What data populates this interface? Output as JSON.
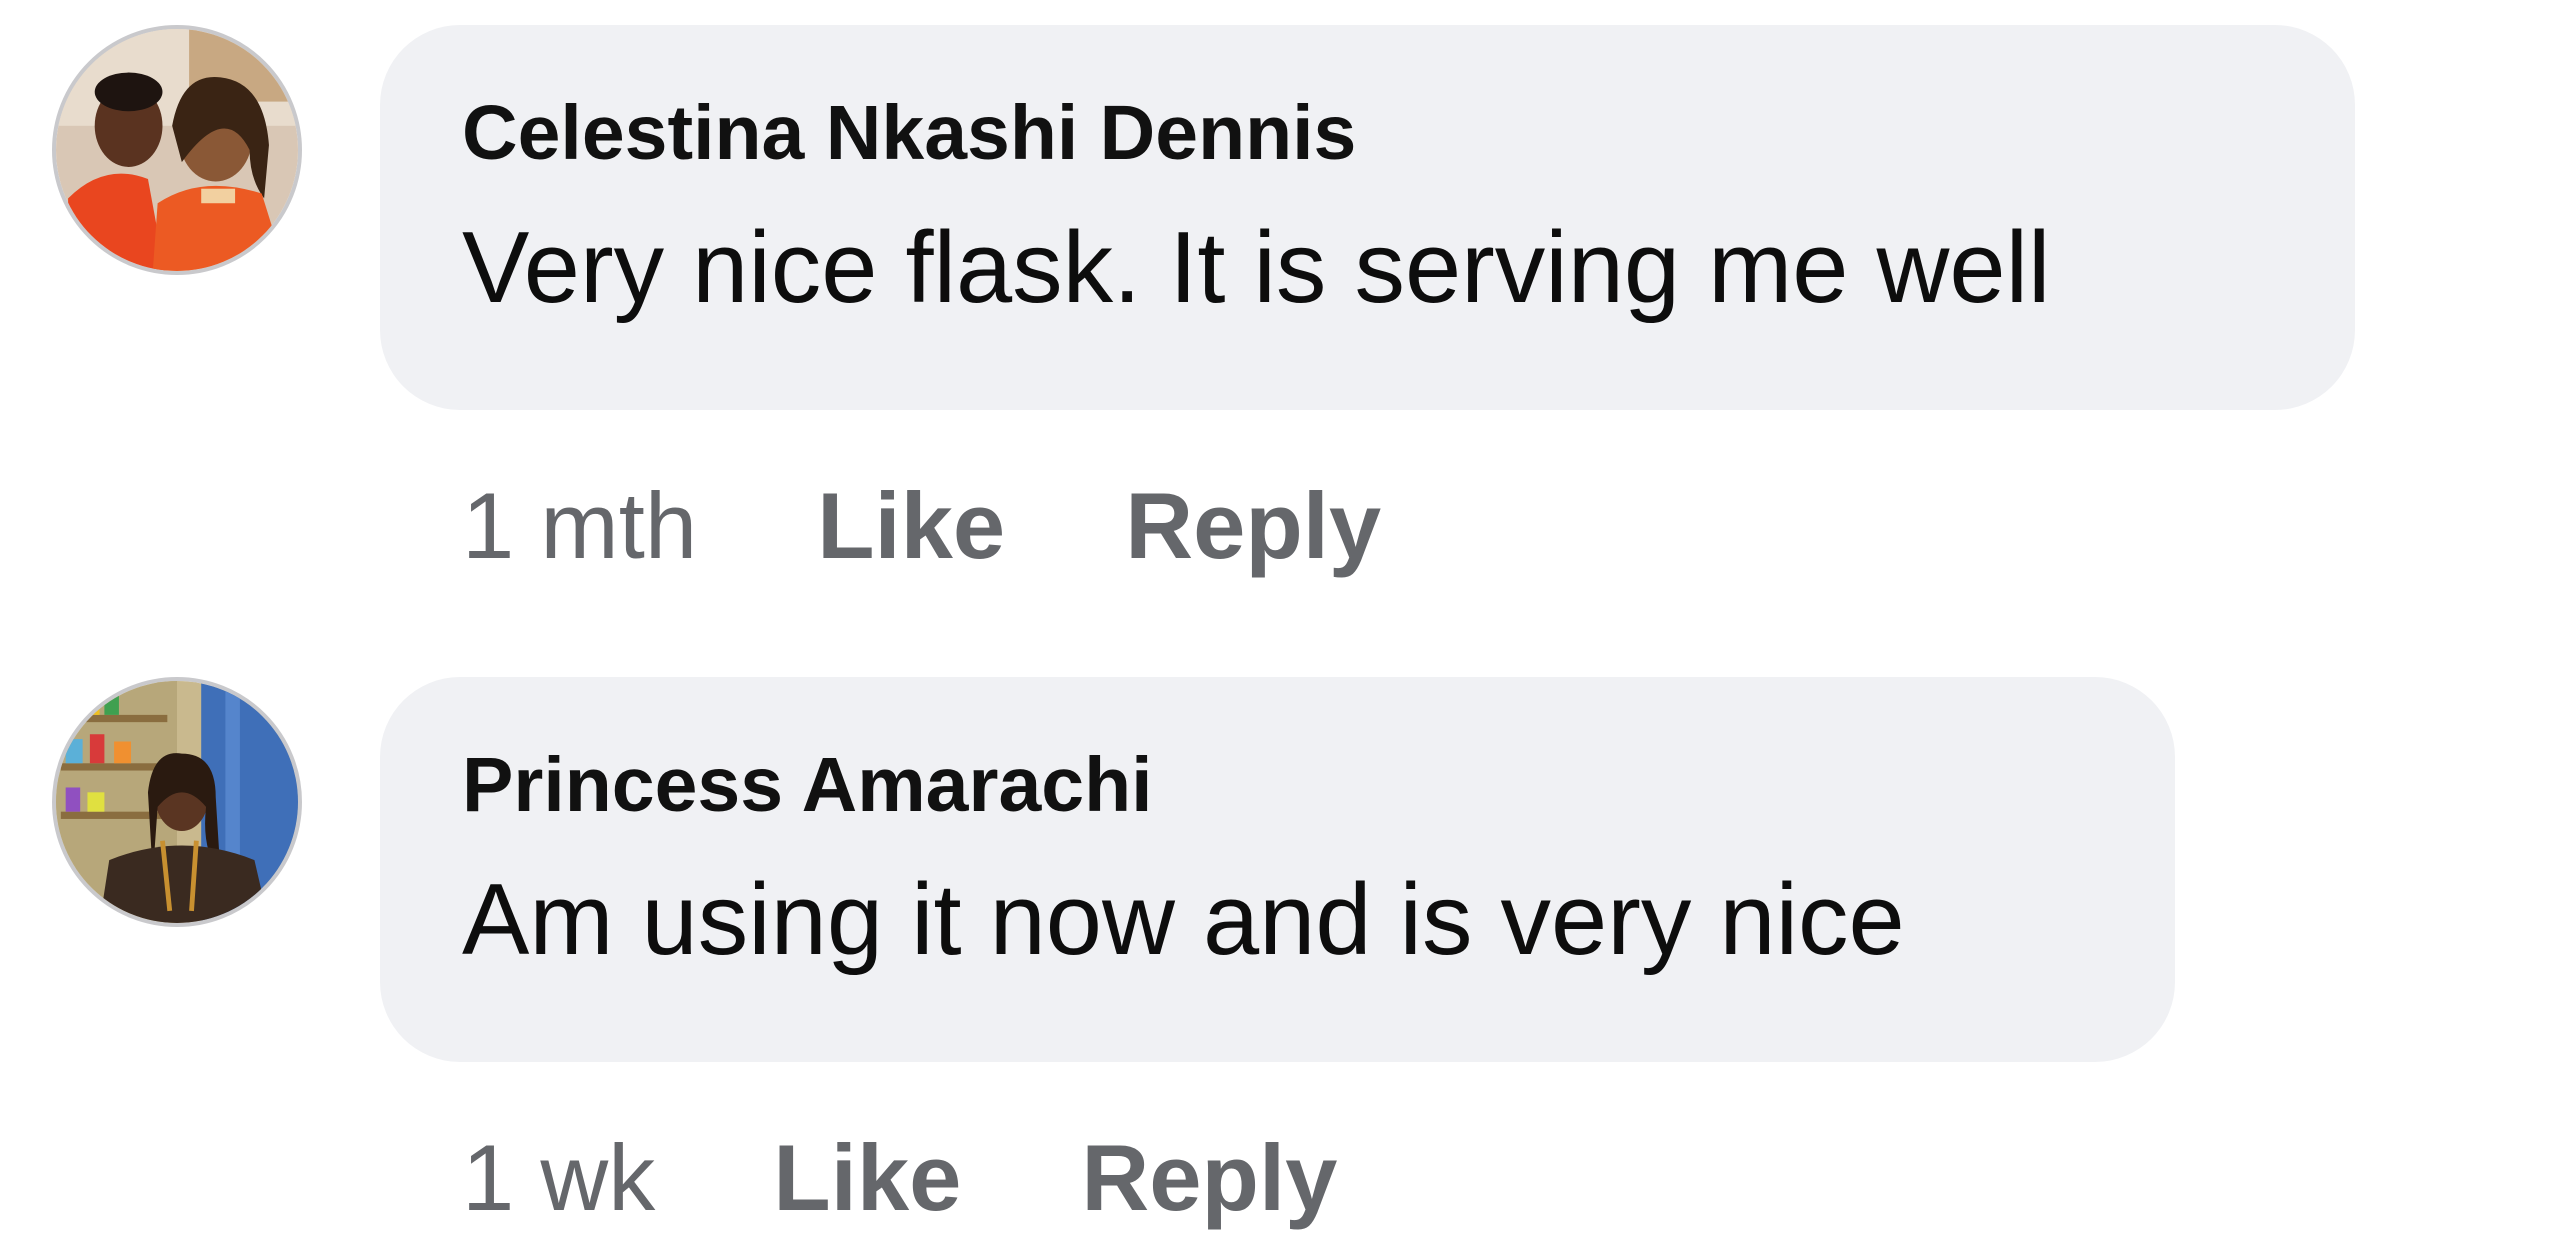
{
  "comments": [
    {
      "author": "Celestina Nkashi Dennis",
      "text": "Very nice flask. It is serving me well",
      "time": "1 mth",
      "like_label": "Like",
      "reply_label": "Reply"
    },
    {
      "author": "Princess Amarachi",
      "text": "Am using it now and is very nice",
      "time": "1 wk",
      "like_label": "Like",
      "reply_label": "Reply"
    }
  ],
  "colors": {
    "bubble_bg": "#f0f1f4",
    "meta_text": "#65676b",
    "author_text": "#111111"
  }
}
